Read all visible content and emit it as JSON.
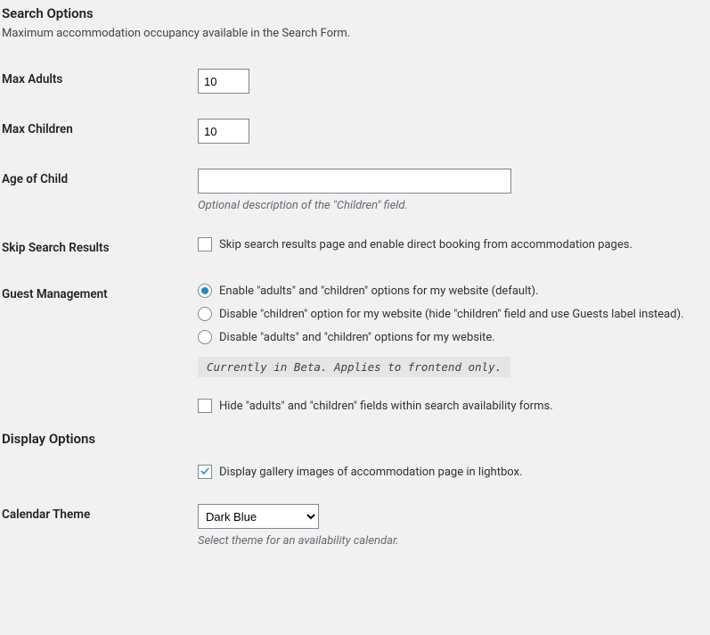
{
  "search_options": {
    "heading": "Search Options",
    "description": "Maximum accommodation occupancy available in the Search Form.",
    "max_adults_label": "Max Adults",
    "max_adults_value": "10",
    "max_children_label": "Max Children",
    "max_children_value": "10",
    "age_of_child_label": "Age of Child",
    "age_of_child_value": "",
    "age_of_child_desc": "Optional description of the \"Children\" field.",
    "skip_search_label": "Skip Search Results",
    "skip_search_text": "Skip search results page and enable direct booking from accommodation pages.",
    "guest_mgmt_label": "Guest Management",
    "guest_mgmt_opt1": "Enable \"adults\" and \"children\" options for my website (default).",
    "guest_mgmt_opt2": "Disable \"children\" option for my website (hide \"children\" field and use Guests label instead).",
    "guest_mgmt_opt3": "Disable \"adults\" and \"children\" options for my website.",
    "guest_mgmt_beta": "Currently in Beta. Applies to frontend only.",
    "guest_mgmt_hide": "Hide \"adults\" and \"children\" fields within search availability forms."
  },
  "display_options": {
    "heading": "Display Options",
    "lightbox_text": "Display gallery images of accommodation page in lightbox.",
    "calendar_theme_label": "Calendar Theme",
    "calendar_theme_value": "Dark Blue",
    "calendar_theme_desc": "Select theme for an availability calendar."
  }
}
